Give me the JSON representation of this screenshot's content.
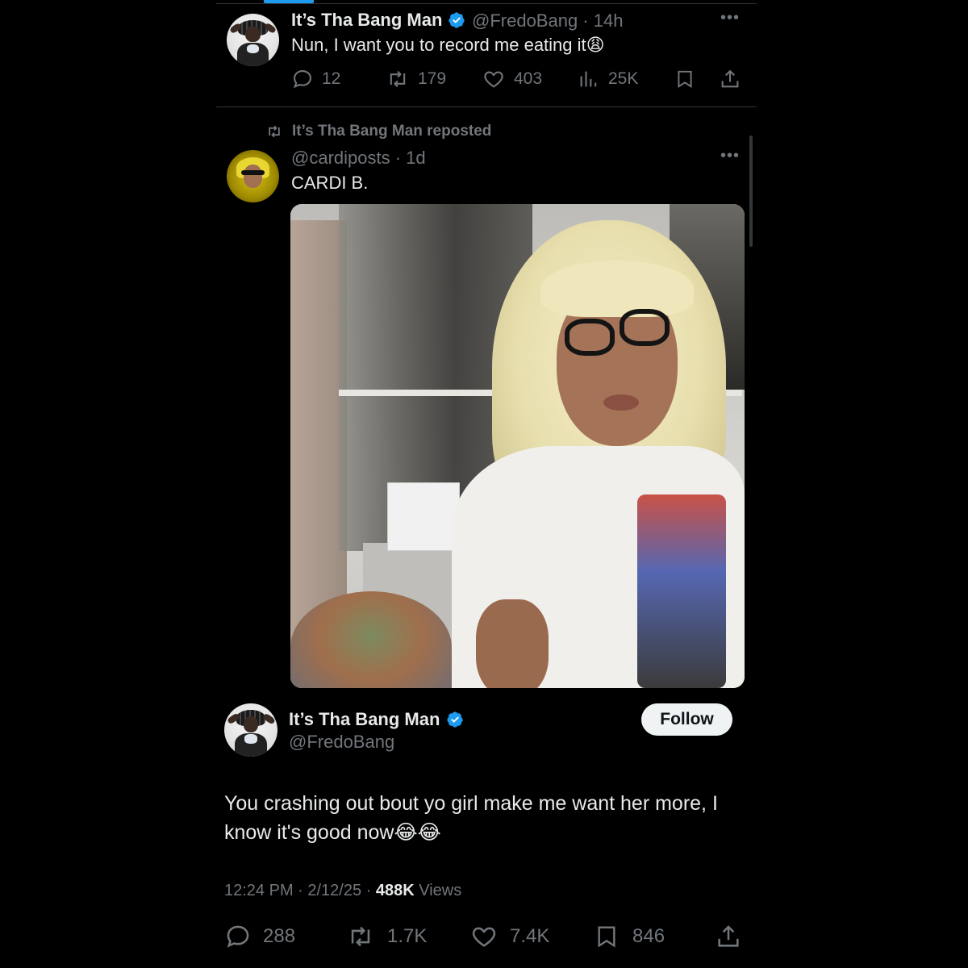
{
  "top_tweet": {
    "name": "It’s Tha Bang Man",
    "handle_time": "@FredoBang · 14h",
    "text": "Nun, I want you to record me eating it😩",
    "actions": {
      "replies": "12",
      "reposts": "179",
      "likes": "403",
      "views": "25K"
    }
  },
  "repost": {
    "label": "It’s Tha Bang Man reposted",
    "handle_time": "@cardiposts · 1d",
    "text": "CARDI B."
  },
  "main_tweet": {
    "name": "It’s Tha Bang Man",
    "handle": "@FredoBang",
    "follow_label": "Follow",
    "text": "You crashing out bout yo girl make me want her more, I know it's good now😂😂",
    "time_date": "12:24 PM · 2/12/25 · ",
    "views_count": "488K",
    "views_label": " Views",
    "actions": {
      "replies": "288",
      "reposts": "1.7K",
      "likes": "7.4K",
      "bookmarks": "846"
    }
  },
  "colors": {
    "background": "#000000",
    "text": "#e7e9ea",
    "muted": "#71767b",
    "accent": "#1d9bf0",
    "follow_bg": "#eff3f4"
  },
  "icons": [
    "verified-badge-icon",
    "more-icon",
    "reply-icon",
    "repost-icon",
    "like-icon",
    "views-icon",
    "bookmark-icon",
    "share-icon"
  ]
}
